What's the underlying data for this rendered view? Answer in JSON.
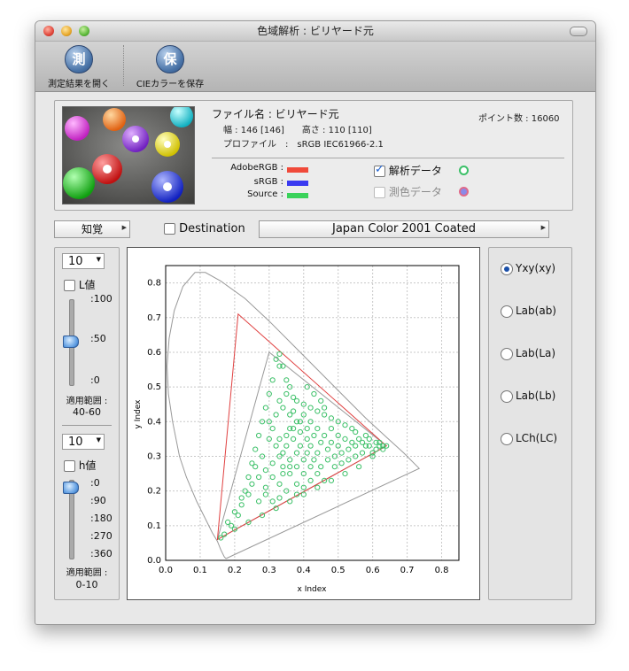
{
  "window": {
    "title": "色域解析 : ビリヤード元"
  },
  "toolbar": {
    "open_icon": "測",
    "open_label": "測定結果を開く",
    "save_icon": "保",
    "save_label": "CIEカラーを保存"
  },
  "info": {
    "filename": "ファイル名 : ビリヤード元",
    "dimensions": "幅 : 146 [146]　　高さ : 110 [110]",
    "profile": "プロファイル　:　sRGB IEC61966-2.1",
    "points": "ポイント数 : 16060",
    "legend": {
      "adobe_label": "AdobeRGB :",
      "srgb_label": "sRGB :",
      "source_label": "Source :",
      "adobe_color": "#f04a3a",
      "srgb_color": "#3a3af0",
      "source_color": "#3ad25a"
    },
    "analysis_label": "解析データ",
    "measure_label": "測色データ"
  },
  "controls": {
    "intent": "知覚",
    "destination_label": "Destination",
    "destination_profile": "Japan Color 2001 Coated"
  },
  "left_panel": {
    "top_spin": "10",
    "l_label": "L値",
    "l_ticks": [
      ":100",
      ":50",
      ":0"
    ],
    "l_range_label": "適用範囲 :",
    "l_range": "40-60",
    "bottom_spin": "10",
    "h_label": "h値",
    "h_ticks": [
      ":0",
      ":90",
      ":180",
      ":270",
      ":360"
    ],
    "h_range_label": "適用範囲 :",
    "h_range": "0-10"
  },
  "right_panel": {
    "options": [
      "Yxy(xy)",
      "Lab(ab)",
      "Lab(La)",
      "Lab(Lb)",
      "LCh(LC)"
    ],
    "selected": "Yxy(xy)"
  },
  "chart_data": {
    "type": "scatter",
    "xlabel": "x Index",
    "ylabel": "y Index",
    "xlim": [
      0.0,
      0.85
    ],
    "ylim": [
      0.0,
      0.85
    ],
    "xticks": [
      "0.0",
      "0.1",
      "0.2",
      "0.3",
      "0.4",
      "0.5",
      "0.6",
      "0.7",
      "0.8"
    ],
    "yticks": [
      "0.0",
      "0.1",
      "0.2",
      "0.3",
      "0.4",
      "0.5",
      "0.6",
      "0.7",
      "0.8"
    ],
    "grid": true,
    "spectral_locus": [
      [
        0.175,
        0.005
      ],
      [
        0.17,
        0.01
      ],
      [
        0.16,
        0.03
      ],
      [
        0.15,
        0.055
      ],
      [
        0.135,
        0.08
      ],
      [
        0.115,
        0.12
      ],
      [
        0.09,
        0.17
      ],
      [
        0.06,
        0.24
      ],
      [
        0.04,
        0.3
      ],
      [
        0.02,
        0.4
      ],
      [
        0.008,
        0.48
      ],
      [
        0.004,
        0.56
      ],
      [
        0.01,
        0.64
      ],
      [
        0.025,
        0.72
      ],
      [
        0.05,
        0.79
      ],
      [
        0.085,
        0.83
      ],
      [
        0.115,
        0.83
      ],
      [
        0.16,
        0.805
      ],
      [
        0.23,
        0.755
      ],
      [
        0.3,
        0.69
      ],
      [
        0.37,
        0.62
      ],
      [
        0.44,
        0.55
      ],
      [
        0.51,
        0.48
      ],
      [
        0.58,
        0.41
      ],
      [
        0.64,
        0.355
      ],
      [
        0.69,
        0.31
      ],
      [
        0.735,
        0.265
      ]
    ],
    "srgb_gamut": [
      [
        0.64,
        0.33
      ],
      [
        0.3,
        0.6
      ],
      [
        0.15,
        0.06
      ]
    ],
    "adobe_gamut": [
      [
        0.64,
        0.33
      ],
      [
        0.21,
        0.71
      ],
      [
        0.15,
        0.06
      ]
    ],
    "source_points": [
      [
        0.33,
        0.595
      ],
      [
        0.32,
        0.58
      ],
      [
        0.34,
        0.56
      ],
      [
        0.31,
        0.52
      ],
      [
        0.3,
        0.48
      ],
      [
        0.29,
        0.44
      ],
      [
        0.28,
        0.4
      ],
      [
        0.27,
        0.36
      ],
      [
        0.26,
        0.32
      ],
      [
        0.25,
        0.28
      ],
      [
        0.24,
        0.24
      ],
      [
        0.23,
        0.2
      ],
      [
        0.22,
        0.16
      ],
      [
        0.21,
        0.13
      ],
      [
        0.19,
        0.1
      ],
      [
        0.17,
        0.075
      ],
      [
        0.16,
        0.065
      ],
      [
        0.2,
        0.09
      ],
      [
        0.24,
        0.11
      ],
      [
        0.28,
        0.13
      ],
      [
        0.32,
        0.15
      ],
      [
        0.36,
        0.17
      ],
      [
        0.4,
        0.19
      ],
      [
        0.44,
        0.21
      ],
      [
        0.48,
        0.23
      ],
      [
        0.52,
        0.25
      ],
      [
        0.56,
        0.27
      ],
      [
        0.6,
        0.3
      ],
      [
        0.64,
        0.33
      ],
      [
        0.62,
        0.34
      ],
      [
        0.58,
        0.36
      ],
      [
        0.55,
        0.37
      ],
      [
        0.52,
        0.39
      ],
      [
        0.48,
        0.41
      ],
      [
        0.44,
        0.43
      ],
      [
        0.4,
        0.45
      ],
      [
        0.37,
        0.47
      ],
      [
        0.35,
        0.52
      ],
      [
        0.33,
        0.56
      ],
      [
        0.36,
        0.5
      ],
      [
        0.38,
        0.46
      ],
      [
        0.42,
        0.44
      ],
      [
        0.46,
        0.42
      ],
      [
        0.5,
        0.4
      ],
      [
        0.54,
        0.38
      ],
      [
        0.43,
        0.48
      ],
      [
        0.41,
        0.5
      ],
      [
        0.45,
        0.46
      ],
      [
        0.3,
        0.35
      ],
      [
        0.32,
        0.33
      ],
      [
        0.34,
        0.31
      ],
      [
        0.36,
        0.29
      ],
      [
        0.38,
        0.27
      ],
      [
        0.4,
        0.25
      ],
      [
        0.42,
        0.23
      ],
      [
        0.35,
        0.36
      ],
      [
        0.37,
        0.38
      ],
      [
        0.39,
        0.4
      ],
      [
        0.41,
        0.38
      ],
      [
        0.43,
        0.36
      ],
      [
        0.45,
        0.34
      ],
      [
        0.47,
        0.32
      ],
      [
        0.49,
        0.3
      ],
      [
        0.51,
        0.31
      ],
      [
        0.53,
        0.32
      ],
      [
        0.55,
        0.33
      ],
      [
        0.57,
        0.34
      ],
      [
        0.59,
        0.33
      ],
      [
        0.61,
        0.32
      ],
      [
        0.63,
        0.33
      ],
      [
        0.33,
        0.3
      ],
      [
        0.31,
        0.28
      ],
      [
        0.29,
        0.26
      ],
      [
        0.27,
        0.24
      ],
      [
        0.25,
        0.22
      ],
      [
        0.34,
        0.27
      ],
      [
        0.36,
        0.25
      ],
      [
        0.38,
        0.22
      ],
      [
        0.35,
        0.2
      ],
      [
        0.33,
        0.22
      ],
      [
        0.31,
        0.24
      ],
      [
        0.33,
        0.35
      ],
      [
        0.35,
        0.33
      ],
      [
        0.37,
        0.35
      ],
      [
        0.39,
        0.33
      ],
      [
        0.41,
        0.31
      ],
      [
        0.43,
        0.29
      ],
      [
        0.45,
        0.27
      ],
      [
        0.47,
        0.29
      ],
      [
        0.49,
        0.27
      ],
      [
        0.51,
        0.28
      ],
      [
        0.53,
        0.29
      ],
      [
        0.55,
        0.3
      ],
      [
        0.57,
        0.31
      ],
      [
        0.3,
        0.4
      ],
      [
        0.32,
        0.42
      ],
      [
        0.34,
        0.44
      ],
      [
        0.36,
        0.42
      ],
      [
        0.38,
        0.4
      ],
      [
        0.4,
        0.42
      ],
      [
        0.42,
        0.4
      ],
      [
        0.44,
        0.38
      ],
      [
        0.46,
        0.36
      ],
      [
        0.48,
        0.34
      ],
      [
        0.5,
        0.36
      ],
      [
        0.52,
        0.35
      ],
      [
        0.54,
        0.34
      ],
      [
        0.56,
        0.35
      ],
      [
        0.58,
        0.33
      ],
      [
        0.46,
        0.44
      ],
      [
        0.48,
        0.38
      ],
      [
        0.5,
        0.33
      ],
      [
        0.44,
        0.31
      ],
      [
        0.42,
        0.27
      ],
      [
        0.4,
        0.29
      ],
      [
        0.38,
        0.31
      ],
      [
        0.36,
        0.38
      ],
      [
        0.28,
        0.3
      ],
      [
        0.26,
        0.27
      ],
      [
        0.24,
        0.19
      ],
      [
        0.22,
        0.18
      ],
      [
        0.2,
        0.14
      ],
      [
        0.18,
        0.11
      ],
      [
        0.27,
        0.17
      ],
      [
        0.29,
        0.19
      ],
      [
        0.31,
        0.17
      ],
      [
        0.33,
        0.18
      ],
      [
        0.29,
        0.21
      ],
      [
        0.31,
        0.38
      ],
      [
        0.33,
        0.46
      ],
      [
        0.35,
        0.48
      ],
      [
        0.37,
        0.43
      ],
      [
        0.39,
        0.37
      ],
      [
        0.41,
        0.35
      ],
      [
        0.6,
        0.31
      ],
      [
        0.62,
        0.33
      ],
      [
        0.63,
        0.32
      ],
      [
        0.61,
        0.34
      ],
      [
        0.59,
        0.35
      ],
      [
        0.42,
        0.33
      ],
      [
        0.44,
        0.25
      ],
      [
        0.46,
        0.23
      ],
      [
        0.4,
        0.21
      ],
      [
        0.38,
        0.19
      ],
      [
        0.36,
        0.27
      ],
      [
        0.34,
        0.25
      ]
    ],
    "source_color": "#3cc068",
    "srgb_color": "#999999",
    "adobe_color": "#e04040",
    "locus_color": "#999999"
  }
}
